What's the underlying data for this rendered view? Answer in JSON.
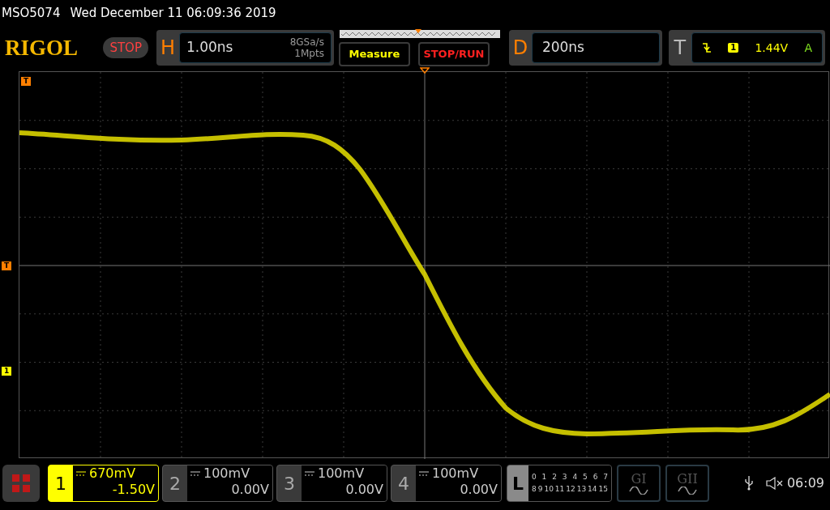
{
  "header": {
    "model": "MSO5074",
    "datetime": "Wed December 11 06:09:36 2019"
  },
  "brand": "RIGOL",
  "run_state": {
    "label": "STOP",
    "kind": "stop"
  },
  "horizontal": {
    "letter": "H",
    "timebase": "1.00ns",
    "sample_rate": "8GSa/s",
    "memory_depth": "1Mpts"
  },
  "buttons": [
    {
      "label": "Measure",
      "kind": "measure"
    },
    {
      "label": "STOP/RUN",
      "kind": "stoprun"
    }
  ],
  "delay": {
    "letter": "D",
    "value": "200ns"
  },
  "trigger": {
    "letter": "T",
    "source": "1",
    "level": "1.44V",
    "mode": "A"
  },
  "grid_markers": [
    {
      "label": "T",
      "color": "#ff7f00"
    },
    {
      "label": "T",
      "color": "#ff7f00"
    },
    {
      "label": "1",
      "color": "#ffff00"
    }
  ],
  "channels": [
    {
      "number": "1",
      "scale": "670mV",
      "offset": "-1.50V",
      "selected": true
    },
    {
      "number": "2",
      "scale": "100mV",
      "offset": "0.00V",
      "selected": false
    },
    {
      "number": "3",
      "scale": "100mV",
      "offset": "0.00V",
      "selected": false
    },
    {
      "number": "4",
      "scale": "100mV",
      "offset": "0.00V",
      "selected": false
    }
  ],
  "logic": {
    "letter": "L",
    "rows": [
      [
        "0",
        "1",
        "2",
        "3",
        "4",
        "5",
        "6",
        "7"
      ],
      [
        "8",
        "9",
        "10",
        "11",
        "12",
        "13",
        "14",
        "15"
      ]
    ]
  },
  "generators": [
    {
      "label": "GI"
    },
    {
      "label": "GII"
    }
  ],
  "status": {
    "time": "06:09"
  }
}
